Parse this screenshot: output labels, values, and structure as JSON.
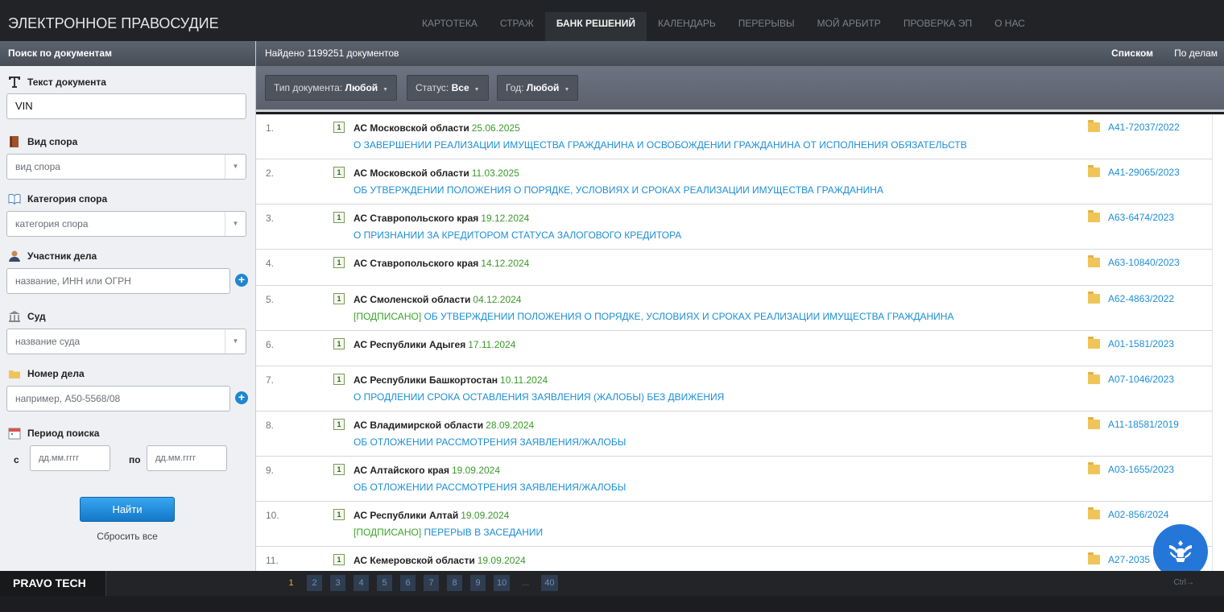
{
  "brand": "ЭЛЕКТРОННОЕ ПРАВОСУДИЕ",
  "nav": [
    "КАРТОТЕКА",
    "СТРАЖ",
    "БАНК РЕШЕНИЙ",
    "КАЛЕНДАРЬ",
    "ПЕРЕРЫВЫ",
    "МОЙ АРБИТР",
    "ПРОВЕРКА ЭП",
    "О НАС"
  ],
  "nav_active": "БАНК РЕШЕНИЙ",
  "sidebar": {
    "title": "Поиск по документам",
    "text_label": "Текст документа",
    "text_value": "VIN",
    "dispute_type_label": "Вид спора",
    "dispute_type_placeholder": "вид спора",
    "category_label": "Категория спора",
    "category_placeholder": "категория спора",
    "participant_label": "Участник дела",
    "participant_placeholder": "название, ИНН или ОГРН",
    "court_label": "Суд",
    "court_placeholder": "название суда",
    "case_label": "Номер дела",
    "case_placeholder": "например, А50-5568/08",
    "period_label": "Период поиска",
    "from_label": "с",
    "from_placeholder": "дд.мм.гггг",
    "to_label": "по",
    "to_placeholder": "дд.мм.гггг",
    "find_button": "Найти",
    "reset": "Сбросить все"
  },
  "main": {
    "found": "Найдено 1199251 документов",
    "view_list": "Списком",
    "view_cases": "По делам",
    "filters": [
      {
        "label": "Тип документа:",
        "value": "Любой"
      },
      {
        "label": "Статус:",
        "value": "Все"
      },
      {
        "label": "Год:",
        "value": "Любой"
      }
    ]
  },
  "results": [
    {
      "num": "1.",
      "court": "АС Московской области",
      "date": "25.06.2025",
      "desc": "О ЗАВЕРШЕНИИ РЕАЛИЗАЦИИ ИМУЩЕСТВА ГРАЖДАНИНА И ОСВОБОЖДЕНИИ ГРАЖДАНИНА ОТ ИСПОЛНЕНИЯ ОБЯЗАТЕЛЬСТВ",
      "signed": "",
      "case": "А41-72037/2022"
    },
    {
      "num": "2.",
      "court": "АС Московской области",
      "date": "11.03.2025",
      "desc": "ОБ УТВЕРЖДЕНИИ ПОЛОЖЕНИЯ О ПОРЯДКЕ, УСЛОВИЯХ И СРОКАХ РЕАЛИЗАЦИИ ИМУЩЕСТВА ГРАЖДАНИНА",
      "signed": "",
      "case": "А41-29065/2023"
    },
    {
      "num": "3.",
      "court": "АС Ставропольского края",
      "date": "19.12.2024",
      "desc": "О ПРИЗНАНИИ ЗА КРЕДИТОРОМ СТАТУСА ЗАЛОГОВОГО КРЕДИТОРА",
      "signed": "",
      "case": "А63-6474/2023"
    },
    {
      "num": "4.",
      "court": "АС Ставропольского края",
      "date": "14.12.2024",
      "desc": "",
      "signed": "",
      "case": "А63-10840/2023"
    },
    {
      "num": "5.",
      "court": "АС Смоленской области",
      "date": "04.12.2024",
      "desc": " ОБ УТВЕРЖДЕНИИ ПОЛОЖЕНИЯ О ПОРЯДКЕ, УСЛОВИЯХ И СРОКАХ РЕАЛИЗАЦИИ ИМУЩЕСТВА ГРАЖДАНИНА",
      "signed": "[ПОДПИСАНО]",
      "case": "А62-4863/2022"
    },
    {
      "num": "6.",
      "court": "АС Республики Адыгея",
      "date": "17.11.2024",
      "desc": "",
      "signed": "",
      "case": "А01-1581/2023"
    },
    {
      "num": "7.",
      "court": "АС Республики Башкортостан",
      "date": "10.11.2024",
      "desc": "О ПРОДЛЕНИИ СРОКА ОСТАВЛЕНИЯ ЗАЯВЛЕНИЯ (ЖАЛОБЫ) БЕЗ ДВИЖЕНИЯ",
      "signed": "",
      "case": "А07-1046/2023"
    },
    {
      "num": "8.",
      "court": "АС Владимирской области",
      "date": "28.09.2024",
      "desc": "ОБ ОТЛОЖЕНИИ РАССМОТРЕНИЯ ЗАЯВЛЕНИЯ/ЖАЛОБЫ",
      "signed": "",
      "case": "А11-18581/2019"
    },
    {
      "num": "9.",
      "court": "АС Алтайского края",
      "date": "19.09.2024",
      "desc": "ОБ ОТЛОЖЕНИИ РАССМОТРЕНИЯ ЗАЯВЛЕНИЯ/ЖАЛОБЫ",
      "signed": "",
      "case": "А03-1655/2023"
    },
    {
      "num": "10.",
      "court": "АС Республики Алтай",
      "date": "19.09.2024",
      "desc": " ПЕРЕРЫВ В ЗАСЕДАНИИ",
      "signed": "[ПОДПИСАНО]",
      "case": "А02-856/2024"
    },
    {
      "num": "11.",
      "court": "АС Кемеровской области",
      "date": "19.09.2024",
      "desc": "",
      "signed": "",
      "case": "А27-2035"
    }
  ],
  "footer": {
    "brand": "PRAVO TECH",
    "pages": [
      "1",
      "2",
      "3",
      "4",
      "5",
      "6",
      "7",
      "8",
      "9",
      "10",
      "...",
      "40"
    ],
    "current_page": "1",
    "hint": "Ctrl→"
  }
}
